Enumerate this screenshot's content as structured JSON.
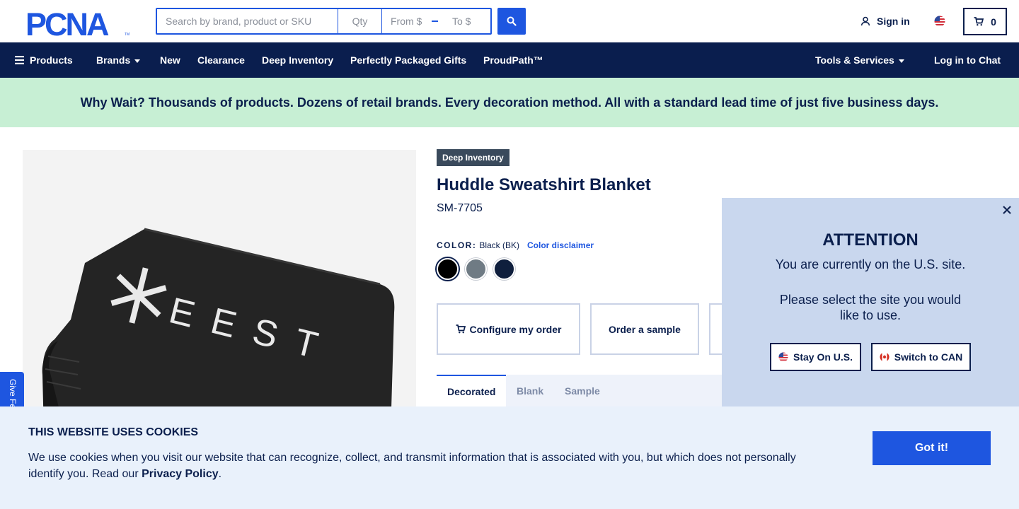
{
  "brand": {
    "logo_text": "PCNA",
    "logo_tm": "TM"
  },
  "search": {
    "placeholder": "Search by brand, product or SKU",
    "qty_placeholder": "Qty",
    "from_placeholder": "From $",
    "to_placeholder": "To $",
    "search_icon": "search-icon"
  },
  "account": {
    "sign_in_label": "Sign in",
    "user_icon": "user-icon",
    "flag": "us-flag-icon"
  },
  "cart": {
    "count": "0",
    "icon": "cart-icon"
  },
  "nav": {
    "products_label": "Products",
    "brands_label": "Brands",
    "new_label": "New",
    "clearance_label": "Clearance",
    "deep_inventory_label": "Deep Inventory",
    "gifts_label": "Perfectly Packaged Gifts",
    "proudpath_label": "ProudPath™",
    "tools_label": "Tools & Services",
    "chat_label": "Log in to Chat"
  },
  "banner": {
    "text": "Why Wait? Thousands of products. Dozens of retail brands. Every decoration method. All with a standard lead time of just five business days."
  },
  "product": {
    "badge": "Deep Inventory",
    "title": "Huddle Sweatshirt Blanket",
    "sku": "SM-7705",
    "color_label": "COLOR:",
    "color_value": "Black (BK)",
    "color_disclaimer": "Color disclaimer",
    "swatches": [
      "#000000",
      "#6f7b84",
      "#0f1f3d"
    ],
    "image_print": "✳EEST"
  },
  "feedback": {
    "label": "Give Feedback"
  },
  "actions": {
    "configure_label": "Configure my order",
    "sample_label": "Order a sample"
  },
  "tabs": {
    "decorated": "Decorated",
    "blank": "Blank",
    "sample": "Sample"
  },
  "attention": {
    "title": "ATTENTION",
    "line1": "You are currently on the U.S. site.",
    "line2": "Please select the site you would like to use.",
    "stay_label": "Stay On U.S.",
    "switch_label": "Switch to CAN"
  },
  "cookie": {
    "title": "THIS WEBSITE USES COOKIES",
    "text_before": "We use cookies when you visit our website that can recognize, collect, and transmit information that is associated with you, but which does not personally identify you. Read our ",
    "link": "Privacy Policy",
    "text_after": ".",
    "button": "Got it!"
  },
  "colors": {
    "navy": "#0a1e4e",
    "accent_blue": "#1e56e0",
    "banner_green": "#c7efd4",
    "popup_bg": "#c9d7ee",
    "cookie_bg": "#e9f1fb"
  }
}
